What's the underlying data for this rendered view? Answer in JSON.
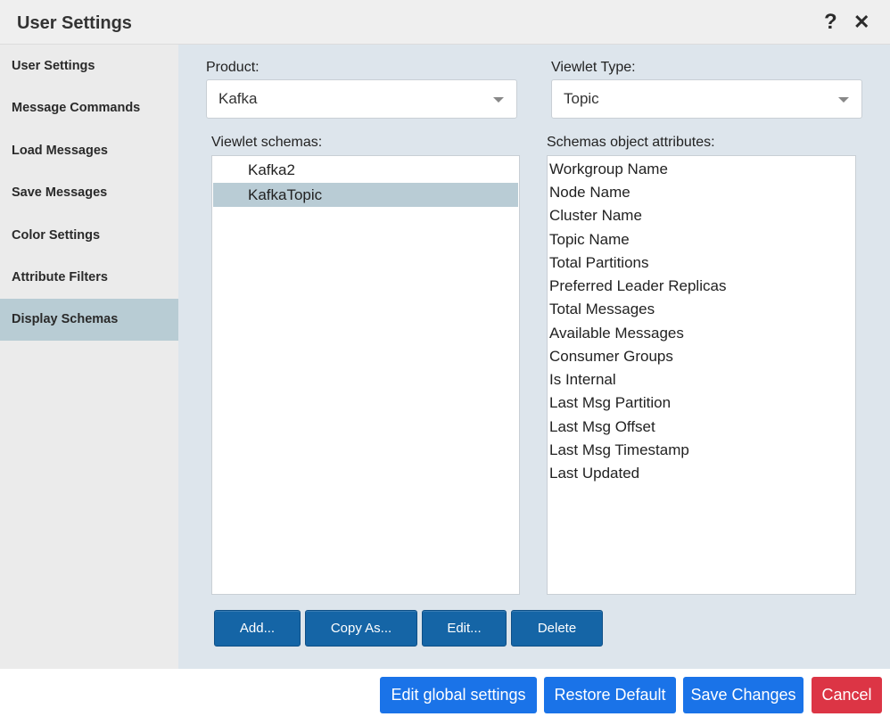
{
  "window": {
    "title": "User Settings",
    "help_icon": "?",
    "close_icon": "✕"
  },
  "sidebar": {
    "items": [
      {
        "label": "User Settings"
      },
      {
        "label": "Message Commands"
      },
      {
        "label": "Load Messages"
      },
      {
        "label": "Save Messages"
      },
      {
        "label": "Color Settings"
      },
      {
        "label": "Attribute Filters"
      },
      {
        "label": "Display Schemas",
        "active": true
      }
    ]
  },
  "form": {
    "product_label": "Product:",
    "product_value": "Kafka",
    "viewlet_type_label": "Viewlet Type:",
    "viewlet_type_value": "Topic",
    "schemas_label": "Viewlet schemas:",
    "schemas": [
      {
        "label": "Kafka2"
      },
      {
        "label": "KafkaTopic",
        "selected": true
      }
    ],
    "attributes_label": "Schemas object attributes:",
    "attributes": [
      "Workgroup Name",
      "Node Name",
      "Cluster Name",
      "Topic Name",
      "Total Partitions",
      "Preferred Leader Replicas",
      "Total Messages",
      "Available Messages",
      "Consumer Groups",
      "Is Internal",
      "Last Msg Partition",
      "Last Msg Offset",
      "Last Msg Timestamp",
      "Last Updated"
    ]
  },
  "schema_actions": {
    "add": "Add...",
    "copy_as": "Copy As...",
    "edit": "Edit...",
    "delete": "Delete"
  },
  "footer": {
    "edit_global": "Edit global settings",
    "restore_default": "Restore Default",
    "save_changes": "Save Changes",
    "cancel": "Cancel"
  },
  "colors": {
    "accent": "#1a73e8",
    "action_button": "#1565a6",
    "danger": "#dc3545",
    "selection": "#b9ccd5",
    "panel": "#dde5ec"
  }
}
